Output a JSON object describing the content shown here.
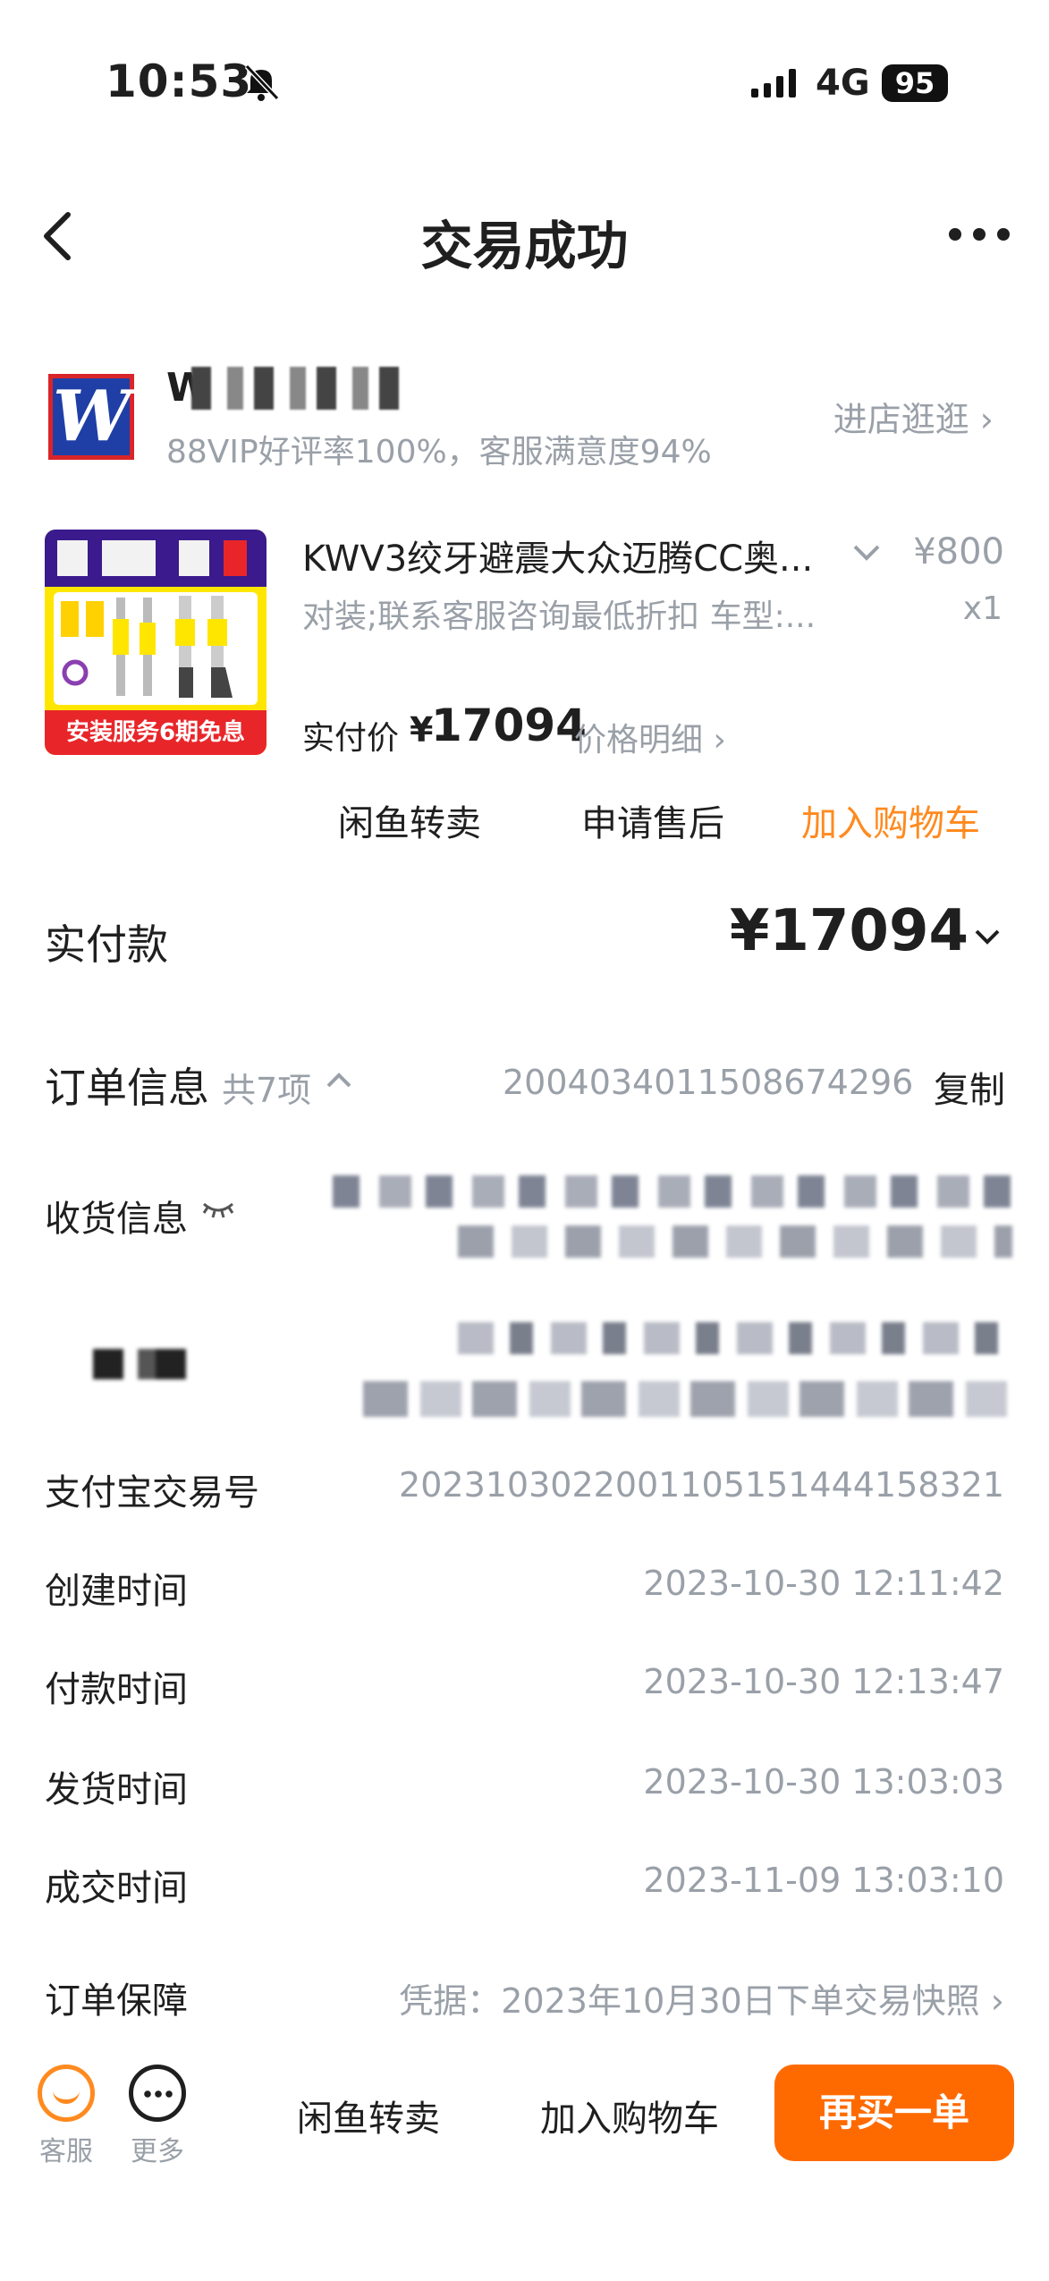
{
  "status_bar": {
    "time": "10:53",
    "network": "4G",
    "battery": "95"
  },
  "nav": {
    "title": "交易成功"
  },
  "shop": {
    "name": "W",
    "meta": "88VIP好评率100%，客服满意度94%",
    "enter_label": "进店逛逛"
  },
  "product": {
    "title": "KWV3绞牙避震大众迈腾CC奥...",
    "spec": "对装;联系客服咨询最低折扣 车型:...",
    "price": "¥800",
    "qty": "x1",
    "image_banner": "安装服务6期免息",
    "paid_label": "实付价",
    "paid_currency": "¥",
    "paid_value": "17094",
    "price_detail": "价格明细"
  },
  "actions": {
    "resell": "闲鱼转卖",
    "after_sale": "申请售后",
    "add_cart": "加入购物车"
  },
  "total": {
    "label": "实付款",
    "value": "¥17094"
  },
  "order": {
    "title": "订单信息",
    "count": "共7项",
    "number": "2004034011508674296",
    "copy": "复制",
    "receive_label": "收货信息",
    "rows": [
      {
        "label": "支付宝交易号",
        "value": "2023103022001105151444158321"
      },
      {
        "label": "创建时间",
        "value": "2023-10-30 12:11:42"
      },
      {
        "label": "付款时间",
        "value": "2023-10-30 12:13:47"
      },
      {
        "label": "发货时间",
        "value": "2023-10-30 13:03:03"
      },
      {
        "label": "成交时间",
        "value": "2023-11-09 13:03:10"
      },
      {
        "label": "订单保障",
        "value": "凭据：2023年10月30日下单交易快照"
      }
    ]
  },
  "bottom_bar": {
    "service": "客服",
    "more": "更多",
    "resell": "闲鱼转卖",
    "add_cart": "加入购物车",
    "buy_again": "再买一单"
  },
  "colors": {
    "accent": "#ff8a1f",
    "buy_button": "#ff6a00",
    "muted": "#9aa0a8"
  },
  "icons": [
    "back-icon",
    "more-icon",
    "bell-mute-icon",
    "signal-icon",
    "chevron-right-icon",
    "chevron-down-icon",
    "chevron-up-icon",
    "eye-closed-icon",
    "customer-service-icon",
    "more-circle-icon"
  ]
}
